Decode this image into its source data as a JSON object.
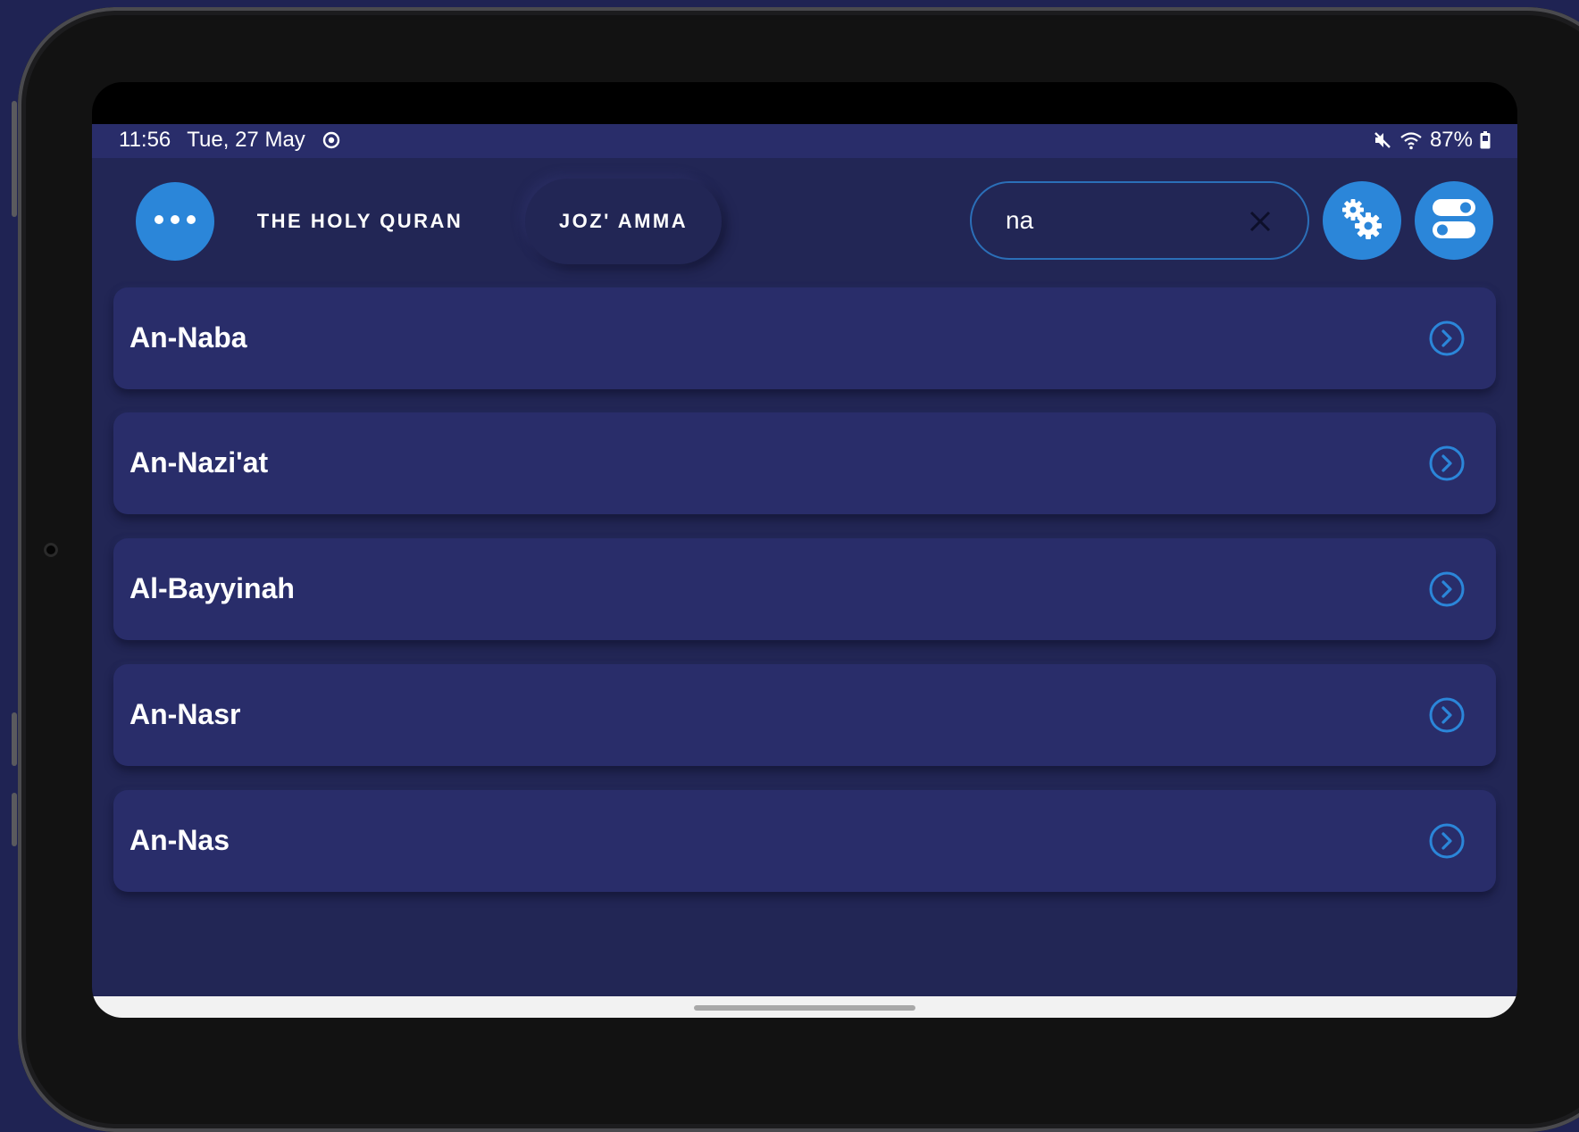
{
  "status_bar": {
    "time": "11:56",
    "date": "Tue, 27 May",
    "battery": "87%"
  },
  "header": {
    "tabs": [
      {
        "label": "THE HOLY QURAN"
      },
      {
        "label": "JOZ' AMMA"
      }
    ],
    "search": {
      "value": "na"
    }
  },
  "surahs": [
    {
      "name": "An-Naba"
    },
    {
      "name": "An-Nazi'at"
    },
    {
      "name": "Al-Bayyinah"
    },
    {
      "name": "An-Nasr"
    },
    {
      "name": "An-Nas"
    }
  ],
  "colors": {
    "background": "#222655",
    "card": "#292d6a",
    "accent": "#2b86d9",
    "text": "#ffffff"
  },
  "icons": {
    "menu": "more-dots-icon",
    "clear": "close-icon",
    "settings": "gears-icon",
    "toggle": "toggle-switches-icon",
    "row": "chevron-right-circle-icon"
  }
}
